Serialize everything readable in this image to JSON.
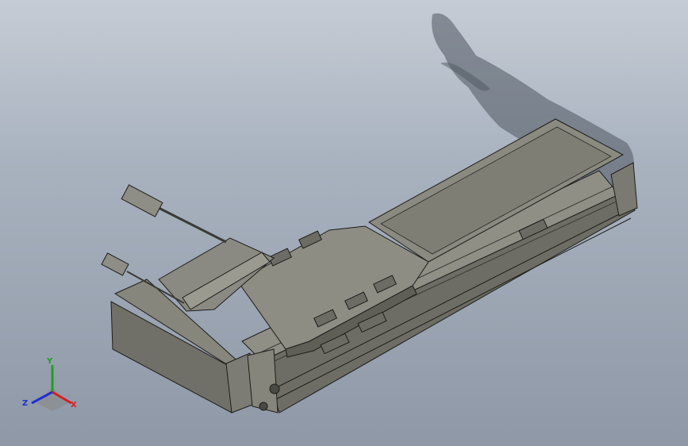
{
  "viewport": {
    "background_top": "#c6ccd5",
    "background_bottom": "#8e98a6"
  },
  "model": {
    "part_fill": "#8b8b80",
    "part_dark": "#5e5e56",
    "part_light": "#a3a39a",
    "edge_color": "#1d1d1a"
  },
  "triad": {
    "x_label": "X",
    "y_label": "Y",
    "z_label": "Z",
    "x_color": "#d42020",
    "y_color": "#20a020",
    "z_color": "#2030d0"
  }
}
